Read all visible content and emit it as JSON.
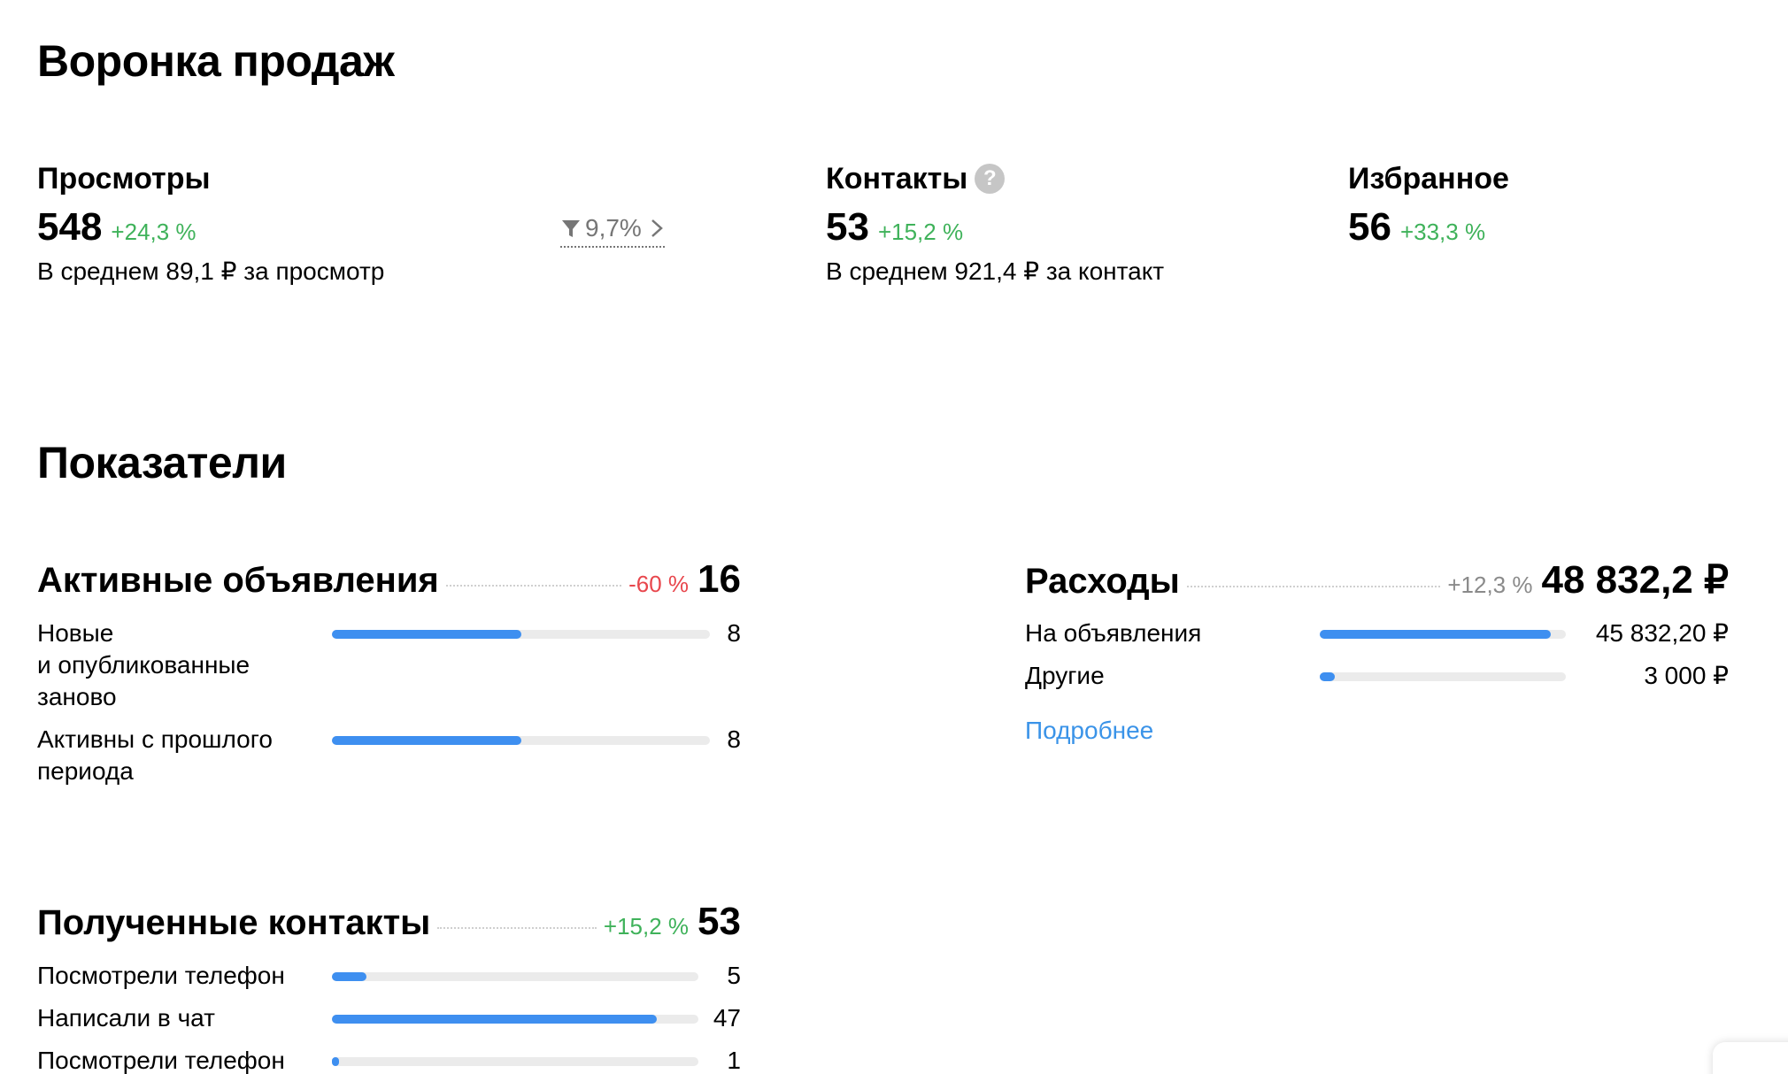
{
  "funnel": {
    "title": "Воронка продаж",
    "views": {
      "label": "Просмотры",
      "value": "548",
      "delta": "+24,3 %",
      "avg": "В среднем 89,1 ₽ за просмотр"
    },
    "conversion": "9,7%",
    "contacts": {
      "label": "Контакты",
      "help": "?",
      "value": "53",
      "delta": "+15,2 %",
      "avg": "В среднем 921,4 ₽ за контакт"
    },
    "favorites": {
      "label": "Избранное",
      "value": "56",
      "delta": "+33,3 %"
    }
  },
  "metrics": {
    "title": "Показатели",
    "active_ads": {
      "title": "Активные объявления",
      "delta": "-60 %",
      "total": "16",
      "rows": [
        {
          "label": "Новые\nи опубликованные\nзаново",
          "value": "8",
          "fraction": 0.5
        },
        {
          "label": "Активны с прошлого\nпериода",
          "value": "8",
          "fraction": 0.5
        }
      ]
    },
    "costs": {
      "title": "Расходы",
      "delta": "+12,3 %",
      "total": "48 832,2 ₽",
      "rows": [
        {
          "label": "На объявления",
          "value": "45 832,20 ₽",
          "fraction": 0.94
        },
        {
          "label": "Другие",
          "value": "3 000 ₽",
          "fraction": 0.06
        }
      ],
      "more_link": "Подробнее"
    },
    "received_contacts": {
      "title": "Полученные контакты",
      "delta": "+15,2 %",
      "total": "53",
      "rows": [
        {
          "label": "Посмотрели телефон",
          "value": "5",
          "fraction": 0.094
        },
        {
          "label": "Написали в чат",
          "value": "47",
          "fraction": 0.887
        },
        {
          "label": "Посмотрели телефон",
          "value": "1",
          "fraction": 0.02
        }
      ]
    }
  },
  "colors": {
    "positive": "#3fb25a",
    "negative": "#e8474d",
    "neutral": "#8a8a8a",
    "bar": "#3e8ff0",
    "bar_track": "#ebebeb",
    "link": "#3a93e8"
  },
  "icons": {
    "filter": "filter-icon",
    "chevron": "chevron-right-icon",
    "help": "help-icon"
  }
}
